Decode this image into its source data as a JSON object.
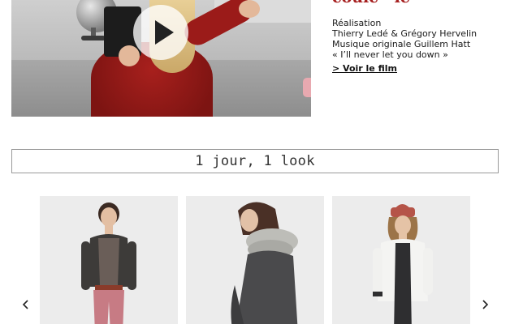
{
  "video": {
    "heading_partial": "coulc’ ‘lé",
    "credits": [
      "Réalisation",
      "Thierry Ledé & Grégory Hervelin",
      "Musique originale Guillem Hatt",
      "« I’ll never let you down »"
    ],
    "link_label": "> Voir le film"
  },
  "look_section": {
    "title": "1 jour, 1 look"
  },
  "carousel": {
    "prev_symbol": "‹",
    "next_symbol": "›",
    "items": [
      {
        "icon": "look-photo-grey-cardigan-pink-trousers"
      },
      {
        "icon": "look-photo-grey-dress-snood"
      },
      {
        "icon": "look-photo-white-jacket-red-beanie"
      }
    ]
  },
  "colors": {
    "accent": "#a51e1e",
    "border": "#9a9a9a",
    "card_bg": "#ebebeb"
  }
}
